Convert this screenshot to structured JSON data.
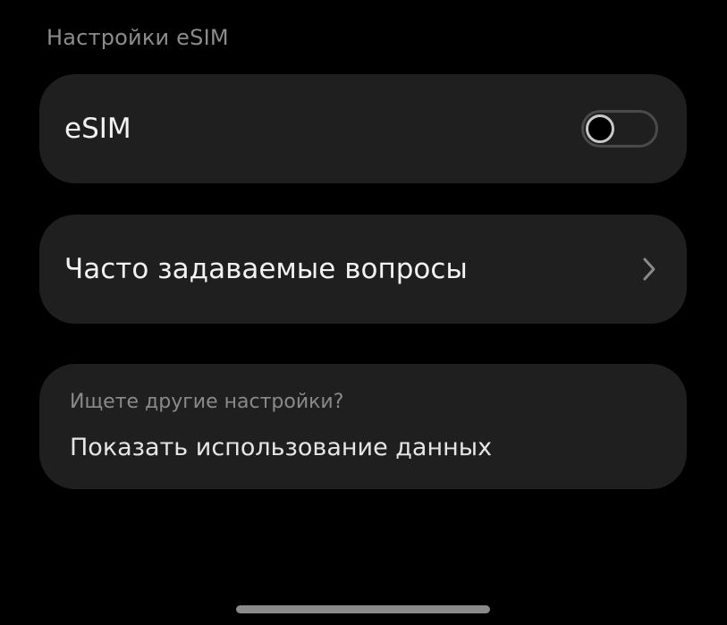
{
  "header": {
    "section_title": "Настройки eSIM"
  },
  "esim_row": {
    "label": "eSIM",
    "toggle_on": false
  },
  "faq_row": {
    "label": "Часто задаваемые вопросы",
    "chevron_icon": "chevron-right-icon"
  },
  "other_settings": {
    "hint": "Ищете другие настройки?",
    "link": "Показать использование данных"
  },
  "colors": {
    "background": "#000000",
    "card": "#1f1f1f",
    "primary_text": "#f2f2f2",
    "secondary_text": "#8c8c8c"
  }
}
